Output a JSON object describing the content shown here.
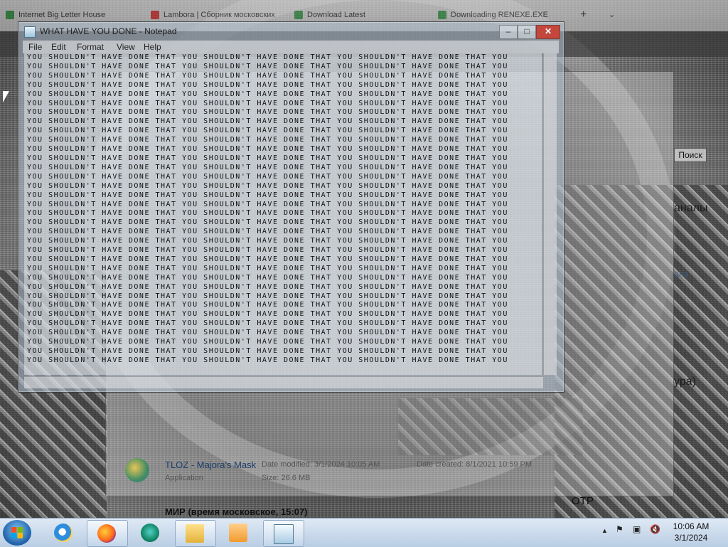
{
  "browser": {
    "tabs": [
      {
        "title": "Internet Big Letter House",
        "fav": "#2a8a3a"
      },
      {
        "title": "Lambora | Сборник московских",
        "fav": "#cc2222"
      },
      {
        "title": "Download Latest",
        "fav": "#2a8a3a"
      },
      {
        "title": "Downloading RENEXE.EXE",
        "fav": "#2a8a3a"
      }
    ]
  },
  "explorer": {
    "search_label": "Поиск",
    "right_texts": [
      "аналы",
      "ура)"
    ],
    "right_links": [
      "ала"
    ],
    "file": {
      "name": "TLOZ - Majora's Mask",
      "type": "Application",
      "modified": "Date modified: 3/1/2024 10:05 AM",
      "created": "Date created: 8/1/2021 10:59 PM",
      "size": "Size: 26.6 MB"
    },
    "news": "МИР (время московское, 15:07)",
    "otr": "ОТР"
  },
  "notepad": {
    "title": "WHAT HAVE YOU DONE - Notepad",
    "menu": [
      "File",
      "Edit",
      "Format",
      "View",
      "Help"
    ],
    "line_text": "YOU SHOULDN'T HAVE DONE THAT YOU SHOULDN'T HAVE DONE THAT YOU SHOULDN'T HAVE DONE THAT YOU",
    "line_count": 34
  },
  "taskbar": {
    "apps": [
      {
        "name": "internet-explorer",
        "cls": "ie",
        "active": false
      },
      {
        "name": "firefox",
        "cls": "ff",
        "active": true
      },
      {
        "name": "edge",
        "cls": "edge",
        "active": false
      },
      {
        "name": "file-explorer",
        "cls": "folder",
        "active": true
      },
      {
        "name": "media-player",
        "cls": "media",
        "active": false
      },
      {
        "name": "notepad",
        "cls": "notepad-ico",
        "active": true
      }
    ],
    "tray": {
      "expand": "▲",
      "flag": "⚑",
      "network": "▣",
      "volume": "🔇"
    },
    "time": "10:06 AM",
    "date": "3/1/2024"
  }
}
